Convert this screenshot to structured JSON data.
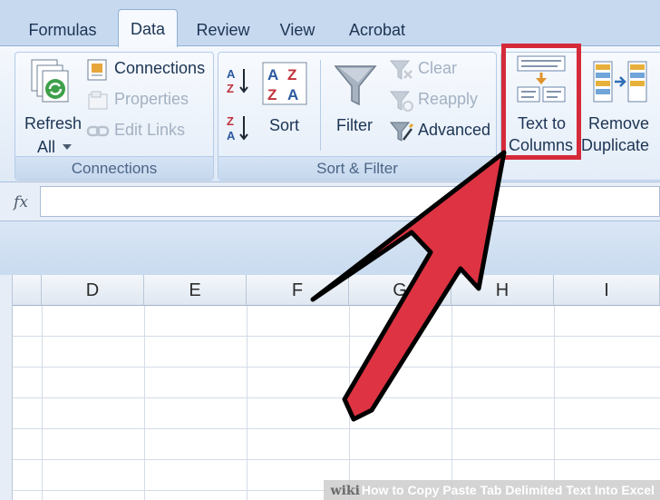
{
  "ribbon_tabs": [
    {
      "label": "Formulas",
      "active": false
    },
    {
      "label": "Data",
      "active": true
    },
    {
      "label": "Review",
      "active": false
    },
    {
      "label": "View",
      "active": false
    },
    {
      "label": "Acrobat",
      "active": false
    }
  ],
  "connections_group": {
    "refresh_all_line1": "Refresh",
    "refresh_all_line2": "All",
    "connections": "Connections",
    "properties": "Properties",
    "edit_links": "Edit Links",
    "label": "Connections"
  },
  "sort_filter_group": {
    "sort": "Sort",
    "filter": "Filter",
    "clear": "Clear",
    "reapply": "Reapply",
    "advanced": "Advanced",
    "label": "Sort & Filter"
  },
  "data_tools": {
    "text_to_columns_line1": "Text to",
    "text_to_columns_line2": "Columns",
    "remove_duplicates_line1": "Remove",
    "remove_duplicates_line2": "Duplicate"
  },
  "formula_bar": {
    "fx_label": "fx",
    "value": ""
  },
  "column_headers": [
    "D",
    "E",
    "F",
    "G",
    "H",
    "I"
  ],
  "watermark": {
    "brand": "wiki",
    "title": "How to Copy Paste Tab Delimited Text Into Excel"
  },
  "colors": {
    "highlight": "#d52a3a",
    "arrow_fill": "#de3342",
    "arrow_outline": "#000000"
  }
}
